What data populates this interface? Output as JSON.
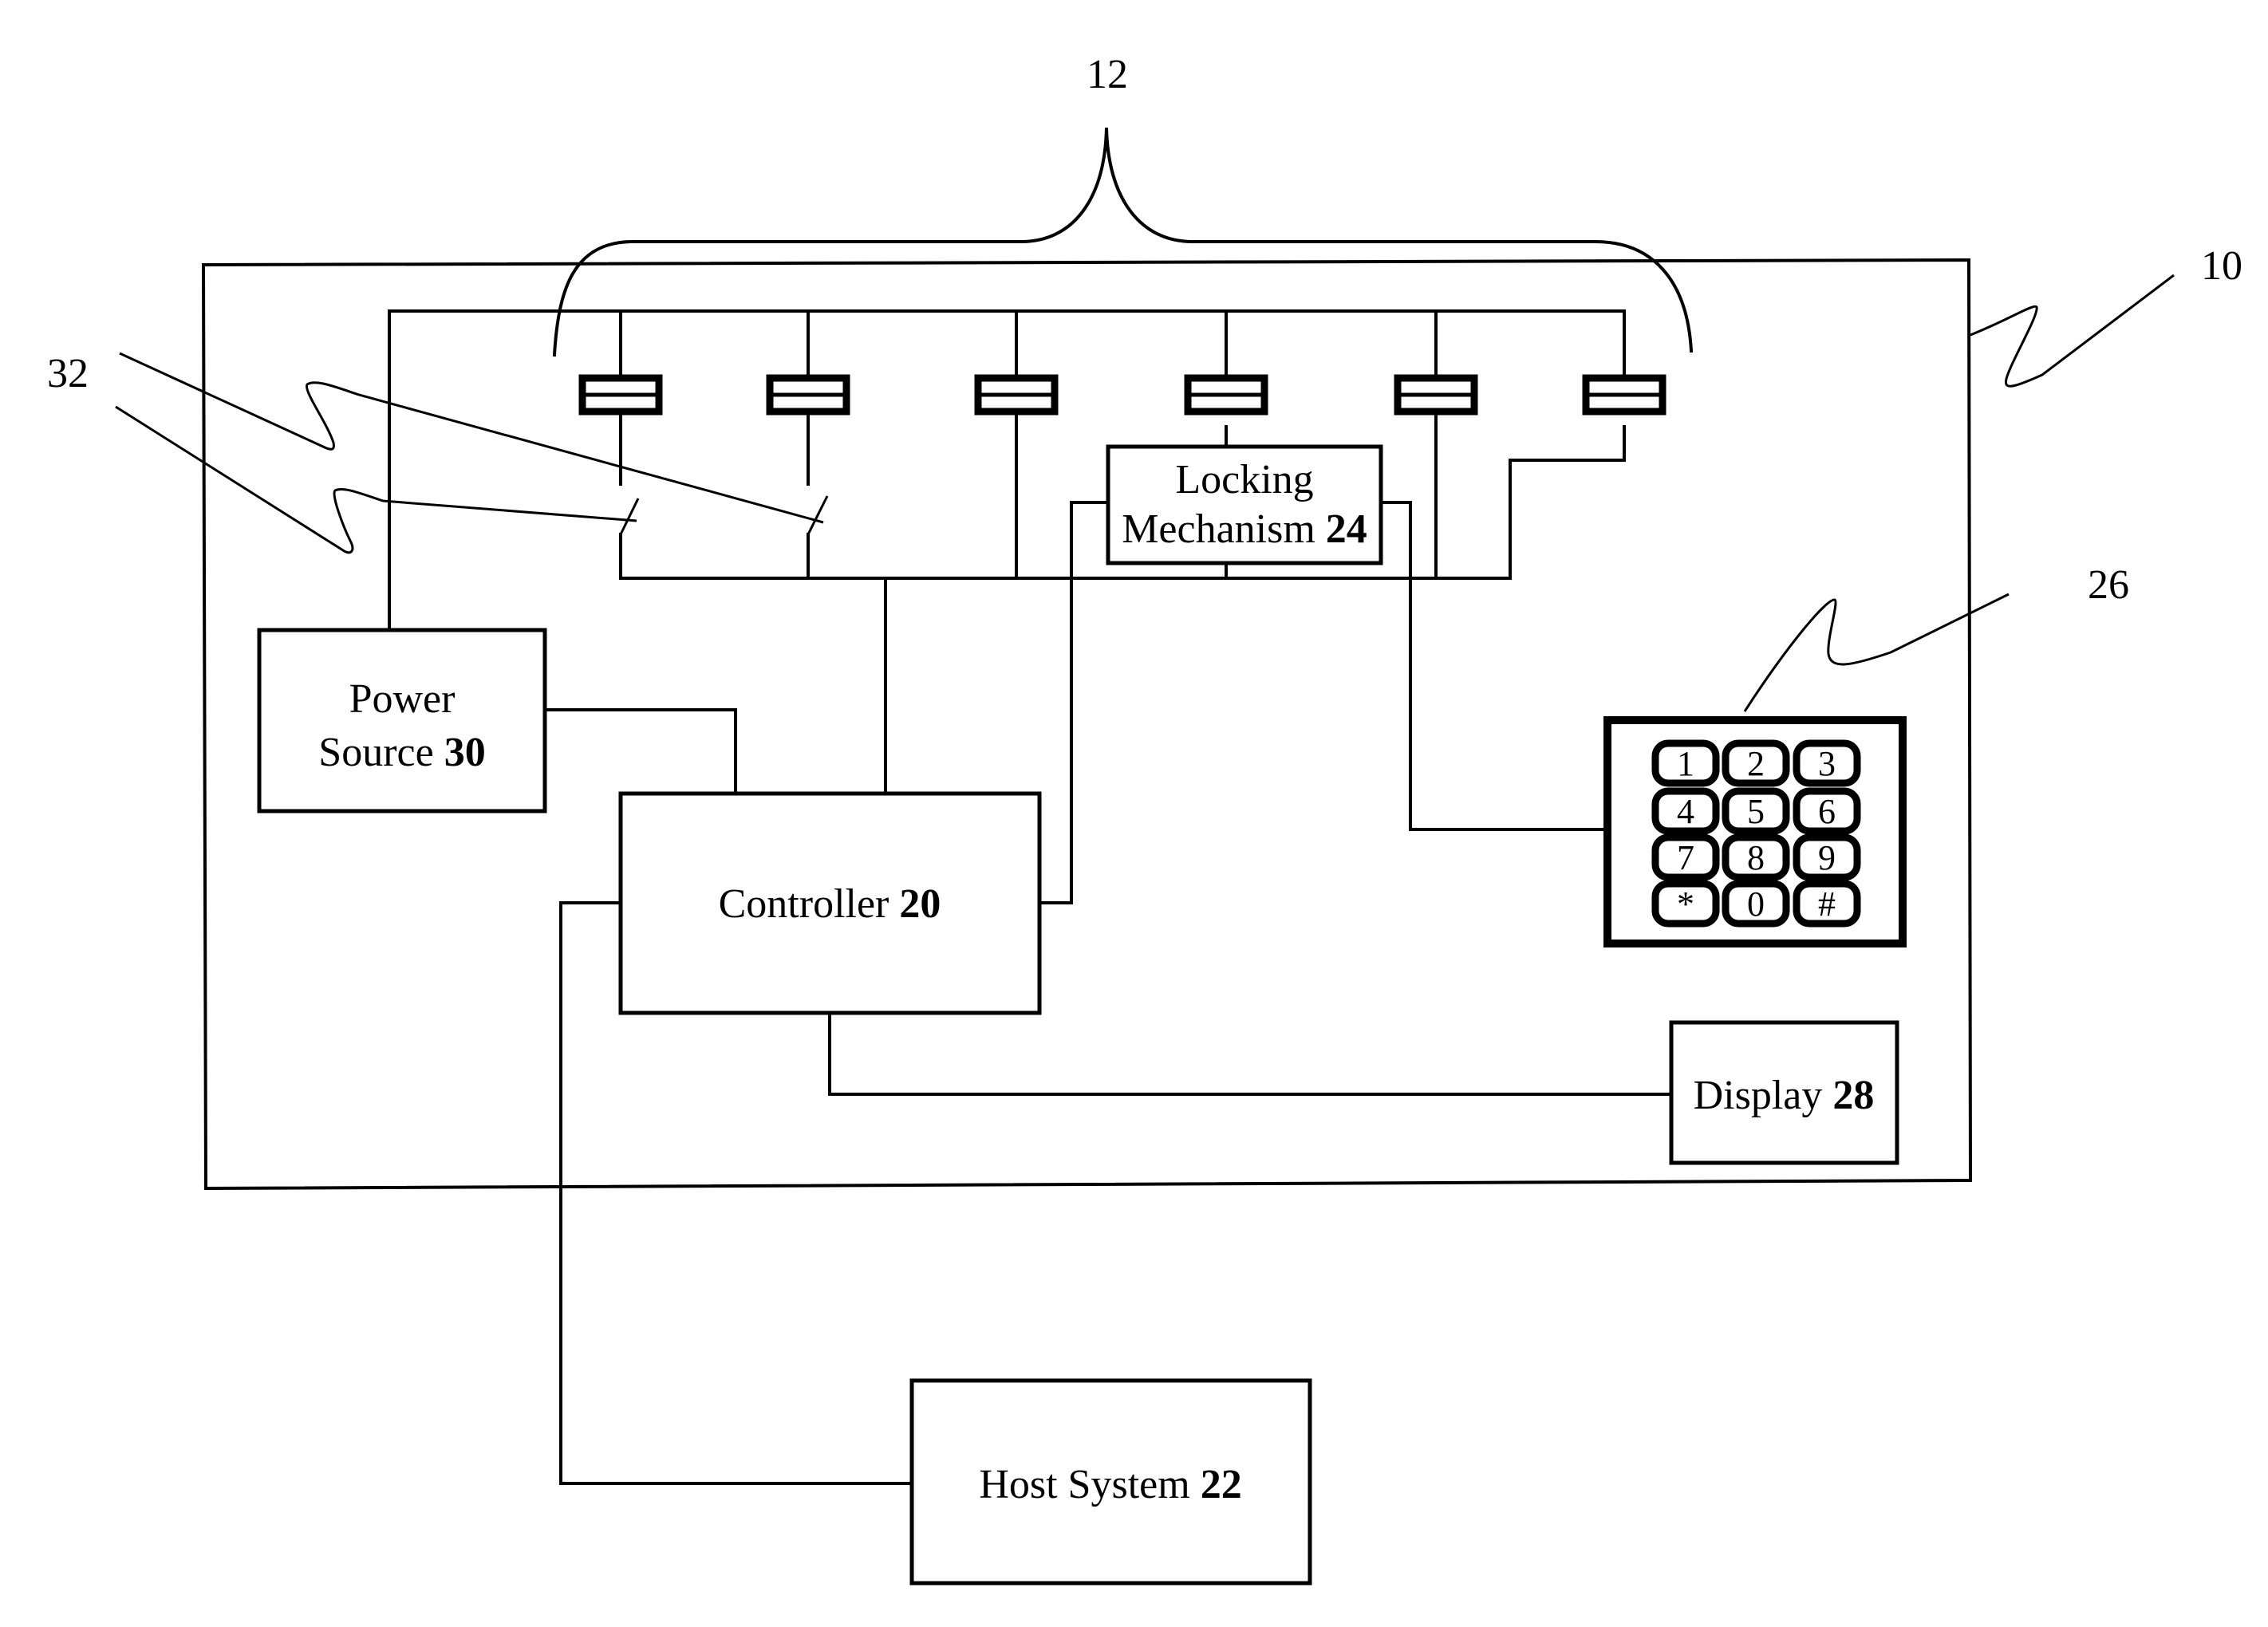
{
  "figure": {
    "type": "patent block diagram",
    "reference_labels": {
      "device": "10",
      "receptacles": "12",
      "keypad": "26",
      "switches": "32"
    },
    "blocks": {
      "locking_mechanism": {
        "name_line1": "Locking",
        "name_line2": "Mechanism",
        "number": "24"
      },
      "power_source": {
        "name_line1": "Power",
        "name_line2": "Source",
        "number": "30"
      },
      "controller": {
        "name": "Controller",
        "number": "20"
      },
      "display": {
        "name": "Display",
        "number": "28"
      },
      "host_system": {
        "name": "Host System",
        "number": "22"
      }
    },
    "keypad_keys": [
      "1",
      "2",
      "3",
      "4",
      "5",
      "6",
      "7",
      "8",
      "9",
      "*",
      "0",
      "#"
    ],
    "fuse_count": 6,
    "switch_count": 2
  }
}
